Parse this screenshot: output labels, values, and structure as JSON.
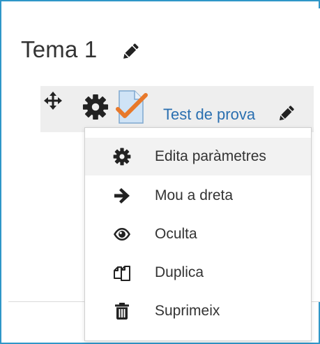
{
  "section": {
    "title": "Tema 1",
    "edit_icon": "pencil-icon"
  },
  "activity": {
    "name": "Test de prova",
    "icons": [
      "move-icon",
      "gear-icon",
      "quiz-file-icon",
      "pencil-icon"
    ]
  },
  "menu": {
    "items": [
      {
        "label": "Edita paràmetres",
        "icon": "gear-icon"
      },
      {
        "label": "Mou a dreta",
        "icon": "arrow-right-icon"
      },
      {
        "label": "Oculta",
        "icon": "eye-icon"
      },
      {
        "label": "Duplica",
        "icon": "copy-icon"
      },
      {
        "label": "Suprimeix",
        "icon": "trash-icon"
      }
    ]
  },
  "colors": {
    "frame_border": "#2f96c8",
    "link": "#2a6fb0",
    "check": "#e8792b",
    "file": "#cfe3f6",
    "text": "#333333"
  }
}
